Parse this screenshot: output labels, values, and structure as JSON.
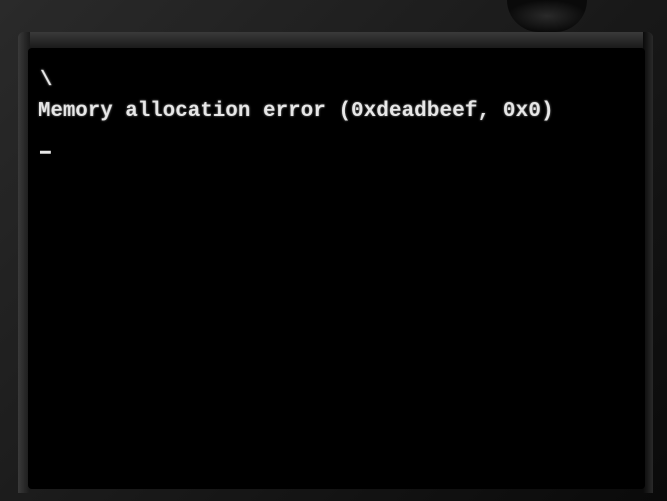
{
  "terminal": {
    "spinner_char": "\\",
    "error_message": "Memory allocation error (0xdeadbeef, 0x0)",
    "cursor": "_"
  }
}
